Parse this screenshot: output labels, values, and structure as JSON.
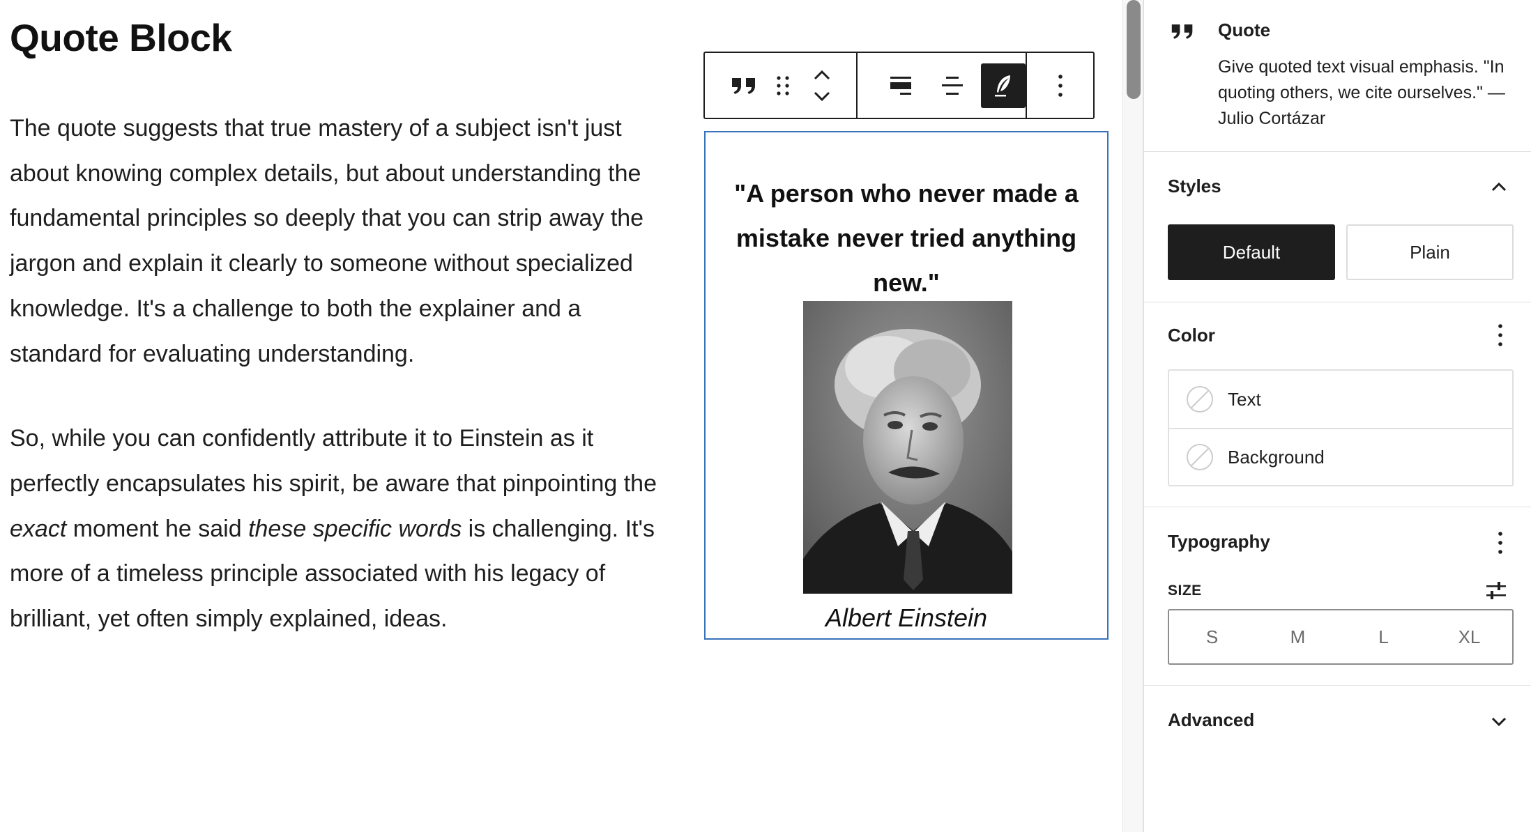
{
  "editor": {
    "title": "Quote Block",
    "paragraph1": "The quote suggests that true mastery of a subject isn't just about knowing complex details, but about understanding the fundamental principles so deeply that you can strip away the jargon and explain it clearly to someone without specialized knowledge. It's a challenge to both the explainer and a standard for evaluating understanding.",
    "paragraph2": {
      "part1": "So, while you can confidently attribute it to Einstein as it perfectly encapsulates his spirit, be aware that pinpointing the ",
      "em1": "exact",
      "part2": " moment he said ",
      "em2": "these specific words",
      "part3": " is challenging. It's more of a timeless principle associated with his legacy of brilliant, yet often simply explained, ideas."
    },
    "quote": {
      "text": "\"A person who never made a\nmistake never tried anything new.\"",
      "citation": "Albert Einstein"
    }
  },
  "toolbar": {
    "icons": [
      "quote-icon",
      "drag-handle-icon",
      "move-up-down-icon",
      "align-left-icon",
      "align-center-icon",
      "quill-icon",
      "more-vertical-icon"
    ],
    "active": "quill-icon"
  },
  "sidebar": {
    "block_card": {
      "title": "Quote",
      "description": "Give quoted text visual emphasis. \"In quoting others, we cite ourselves.\" — Julio Cortázar"
    },
    "styles": {
      "title": "Styles",
      "options": [
        "Default",
        "Plain"
      ],
      "selected": "Default"
    },
    "color": {
      "title": "Color",
      "items": [
        "Text",
        "Background"
      ]
    },
    "typography": {
      "title": "Typography",
      "size_label": "SIZE",
      "sizes": [
        "S",
        "M",
        "L",
        "XL"
      ]
    },
    "advanced": {
      "title": "Advanced"
    }
  },
  "colors": {
    "selection_border": "#3872b8",
    "dark": "#1e1e1e",
    "border": "#e0e0e0"
  }
}
